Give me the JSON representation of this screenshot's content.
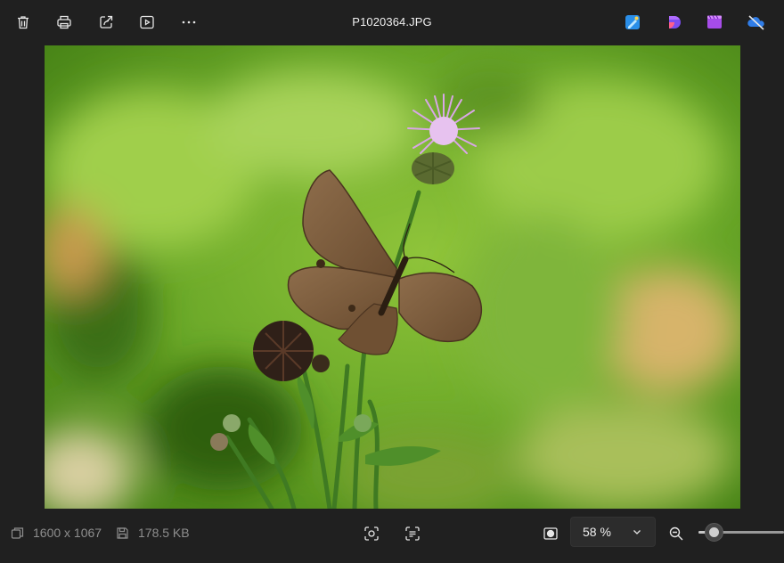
{
  "toolbar": {
    "buttons": [
      {
        "name": "delete",
        "icon": "trash-icon"
      },
      {
        "name": "print",
        "icon": "printer-icon"
      },
      {
        "name": "share",
        "icon": "share-icon"
      },
      {
        "name": "slideshow",
        "icon": "play-icon"
      },
      {
        "name": "more",
        "icon": "more-icon"
      }
    ],
    "file_name": "P1020364.JPG",
    "app_icons": [
      "paint-icon",
      "clipchamp-icon",
      "video-editor-icon",
      "onedrive-icon"
    ]
  },
  "image": {
    "icon": "photo-canvas",
    "accent_colors": {
      "background": "#5fa02a",
      "flower": "#d9a6e6",
      "butterfly": "#7a5a3c"
    }
  },
  "status": {
    "dimensions": "1600 x 1067",
    "file_size": "178.5 KB",
    "zoom_label": "58 %",
    "zoom_level_fraction": 0.58
  },
  "colors": {
    "chrome": "#202020",
    "text": "#e6e6e6",
    "muted": "#8e8e8e"
  }
}
